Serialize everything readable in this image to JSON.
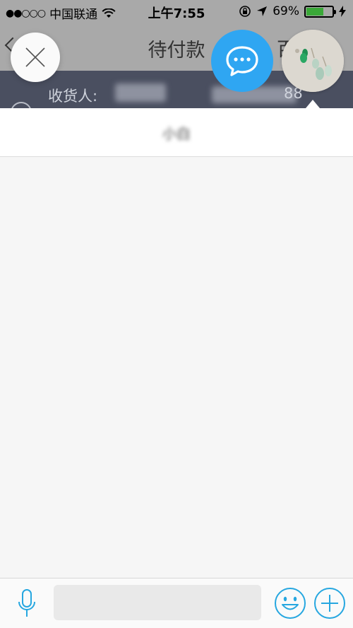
{
  "status_bar": {
    "signal": "●●○○○",
    "carrier": "中国联通",
    "time": "上午7:55",
    "battery_percent": "69%",
    "battery_level": 0.69,
    "battery_color": "#3aa838"
  },
  "nav": {
    "title": "待付款",
    "right_glyph": "百"
  },
  "address": {
    "label": "收货人:",
    "name": "",
    "phone_visible": "88"
  },
  "chat": {
    "contact_name": "小白",
    "input_value": "",
    "input_placeholder": ""
  },
  "icons": {
    "close": "close-icon",
    "chat": "chat-bubble-icon",
    "avatar": "product-avatar",
    "mic": "microphone-icon",
    "emoji": "emoji-icon",
    "plus": "plus-icon"
  },
  "colors": {
    "accent": "#2fa6f2",
    "icon_blue": "#26a7e0",
    "address_strip": "#4a4f60"
  }
}
